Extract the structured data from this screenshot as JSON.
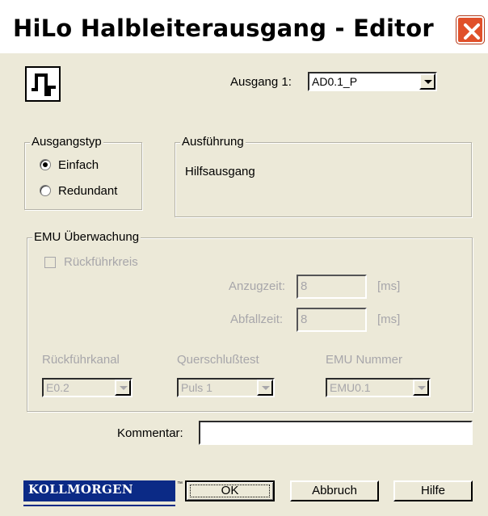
{
  "window": {
    "title": "HiLo Halbleiterausgang - Editor",
    "close_icon": "close-icon"
  },
  "header": {
    "output_icon": "pulse-signal-icon",
    "output_label": "Ausgang 1:",
    "output_value": "AD0.1_P"
  },
  "ausgangstyp": {
    "legend": "Ausgangstyp",
    "options": [
      {
        "label": "Einfach",
        "selected": true
      },
      {
        "label": "Redundant",
        "selected": false
      }
    ]
  },
  "ausfuehrung": {
    "legend": "Ausführung",
    "value": "Hilfsausgang"
  },
  "emu": {
    "legend": "EMU Überwachung",
    "rueckfuehrkreis": "Rückführkreis",
    "anzugzeit_label": "Anzugzeit:",
    "anzugzeit_value": "8",
    "anzugzeit_unit": "[ms]",
    "abfallzeit_label": "Abfallzeit:",
    "abfallzeit_value": "8",
    "abfallzeit_unit": "[ms]",
    "rueckfuehrkanal_label": "Rückführkanal",
    "rueckfuehrkanal_value": "E0.2",
    "querschluss_label": "Querschlußtest",
    "querschluss_value": "Puls 1",
    "emu_nummer_label": "EMU Nummer",
    "emu_nummer_value": "EMU0.1"
  },
  "kommentar": {
    "label": "Kommentar:",
    "value": ""
  },
  "footer": {
    "logo": "KOLLMORGEN",
    "tm": "™",
    "ok_label": "OK",
    "abbruch_label": "Abbruch",
    "hilfe_label": "Hilfe"
  },
  "colors": {
    "dialog_bg": "#ece9d8",
    "close_red": "#e0502a",
    "logo_blue": "#0b2a86",
    "disabled_text": "#a7a6aa"
  }
}
